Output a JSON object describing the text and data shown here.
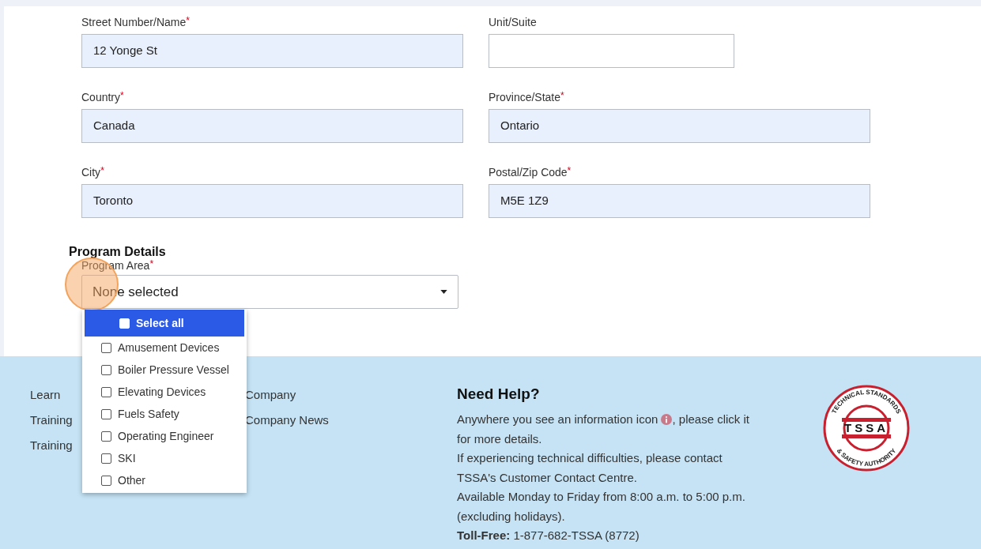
{
  "address_fields": [
    {
      "label": "Street Number/Name",
      "required_mark": "*",
      "value": "12 Yonge St",
      "filled": true,
      "kind": "wide"
    },
    {
      "label": "Unit/Suite",
      "filled": false,
      "kind": "narrow"
    },
    {
      "label": "Country",
      "required_mark": "*",
      "value": "Canada",
      "filled": true,
      "kind": "wide"
    },
    {
      "label": "Province/State",
      "required_mark": "*",
      "value": "Ontario",
      "filled": true,
      "kind": "wide"
    },
    {
      "label": "City",
      "required_mark": "*",
      "value": "Toronto",
      "filled": true,
      "kind": "wide"
    },
    {
      "label": "Postal/Zip Code",
      "required_mark": "*",
      "value": "M5E 1Z9",
      "filled": true,
      "kind": "wide"
    }
  ],
  "program_details": {
    "heading": "Program Details",
    "label": "Program Area",
    "required_mark": "*",
    "value": "None selected",
    "expanded": true,
    "options": [
      {
        "label": "Select all",
        "kind": "select_all",
        "checked": false
      },
      {
        "label": "Amusement Devices",
        "kind": "option",
        "checked": false
      },
      {
        "label": "Boiler Pressure Vessel",
        "kind": "option",
        "checked": false
      },
      {
        "label": "Elevating Devices",
        "kind": "option",
        "checked": false
      },
      {
        "label": "Fuels Safety",
        "kind": "option",
        "checked": false
      },
      {
        "label": "Operating Engineer",
        "kind": "option",
        "checked": false
      },
      {
        "label": "SKI",
        "kind": "option",
        "checked": false
      },
      {
        "label": "Other",
        "kind": "option",
        "checked": false
      }
    ]
  },
  "footer": {
    "columns": [
      {
        "links": [
          "Learn",
          "Training",
          "Training"
        ]
      },
      {
        "links": [
          "Company",
          "Company News"
        ]
      }
    ],
    "help": {
      "heading": "Need Help?",
      "intro_before": "Anywhere you see an information icon",
      "intro_after": ", please click it for more details.",
      "paragraphs": [
        "If experiencing technical difficulties, please contact TSSA's Customer Contact Centre.",
        "Available Monday to Friday from 8:00 a.m. to 5:00 p.m. (excluding holidays).",
        "**Toll-Free:** 1-877-682-TSSA (8772)"
      ]
    },
    "logo": {
      "top_text": "TECHNICAL STANDARDS",
      "center_text": "TSSA",
      "bottom_text": "& SAFETY AUTHORITY"
    }
  }
}
